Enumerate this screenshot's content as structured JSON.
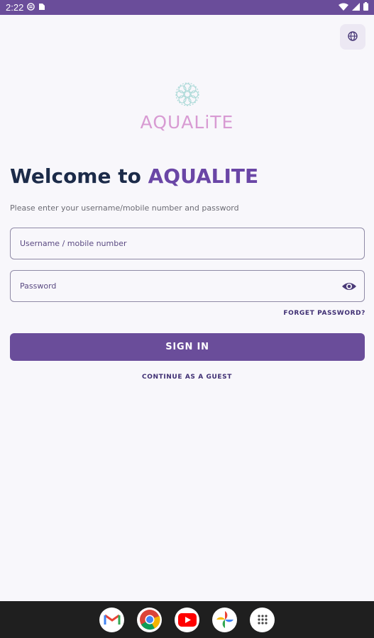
{
  "status_bar": {
    "time": "2:22",
    "icons": [
      "notification-icon",
      "sim-card-icon",
      "wifi-icon",
      "signal-icon",
      "battery-icon"
    ]
  },
  "header": {
    "language_icon": "globe-icon"
  },
  "logo": {
    "text": "AQUALiTE"
  },
  "welcome": {
    "prefix": "Welcome to ",
    "brand": "AQUALITE",
    "subtitle": "Please enter your username/mobile number and password"
  },
  "form": {
    "username_placeholder": "Username / mobile number",
    "password_placeholder": "Password",
    "forgot_label": "FORGET PASSWORD?",
    "signin_label": "SIGN IN",
    "guest_label": "CONTINUE AS A GUEST"
  },
  "dock": {
    "apps": [
      "gmail-icon",
      "chrome-icon",
      "youtube-icon",
      "photos-icon",
      "app-drawer-icon"
    ]
  },
  "colors": {
    "primary": "#6a4d9a",
    "brand_text": "#6a46a6",
    "heading": "#1c2b49",
    "logo_pink": "#d89bd3",
    "logo_teal": "#7cc9c6"
  }
}
